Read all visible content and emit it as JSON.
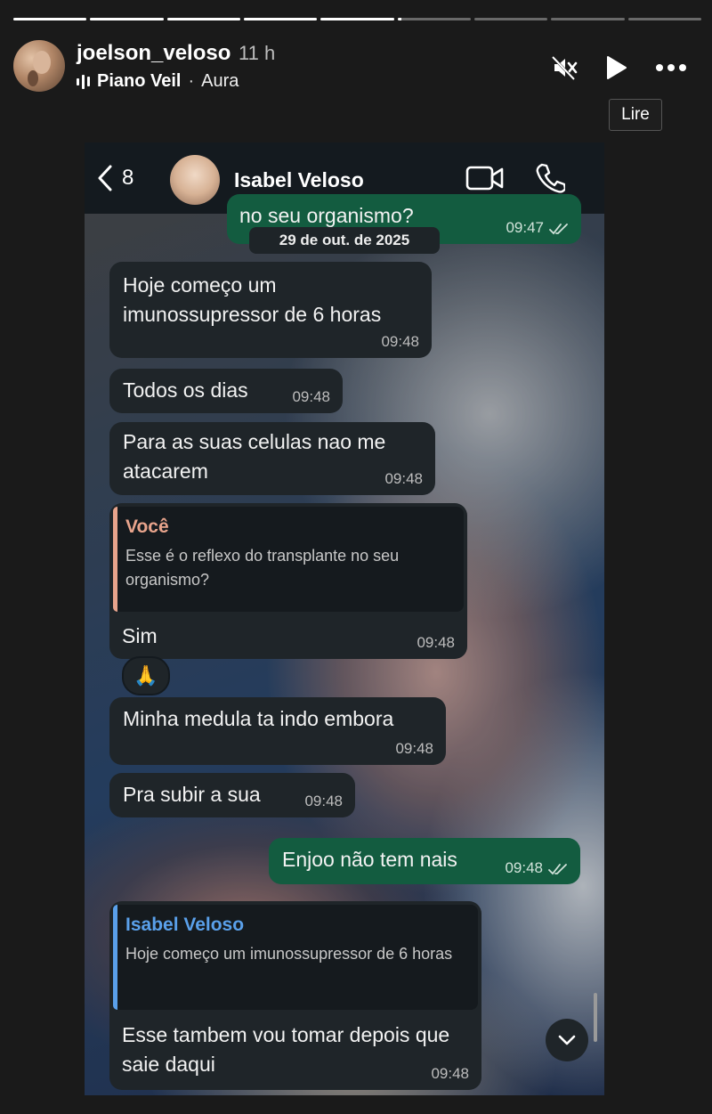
{
  "story": {
    "progress": [
      1,
      1,
      1,
      1,
      1,
      0.05,
      0,
      0,
      0
    ],
    "username": "joelson_veloso",
    "time_ago": "11 h",
    "music": {
      "song": "Piano Veil",
      "separator": "·",
      "artist": "Aura"
    },
    "tooltip": "Lire"
  },
  "chat": {
    "back_count": "8",
    "contact_name": "Isabel Veloso",
    "date_chip": "29 de out. de 2025",
    "messages": [
      {
        "dir": "out",
        "text": "no seu organismo?",
        "time": "09:47"
      },
      {
        "dir": "in",
        "text": "Hoje começo um imunossupressor de 6 horas",
        "time": "09:48"
      },
      {
        "dir": "in",
        "text": "Todos os dias",
        "time": "09:48"
      },
      {
        "dir": "in",
        "text": "Para as suas celulas nao me atacarem",
        "time": "09:48"
      },
      {
        "dir": "in",
        "quote_author": "Você",
        "quote_text": "Esse é o reflexo do transplante no seu organismo?",
        "text": "Sim",
        "time": "09:48",
        "reaction": "🙏"
      },
      {
        "dir": "in",
        "text": "Minha medula ta indo embora",
        "time": "09:48"
      },
      {
        "dir": "in",
        "text": "Pra subir a sua",
        "time": "09:48"
      },
      {
        "dir": "out",
        "text": "Enjoo não tem nais",
        "time": "09:48"
      },
      {
        "dir": "in",
        "quote_author": "Isabel Veloso",
        "quote_text": "Hoje começo um imunossupressor de 6 horas",
        "text": "Esse tambem vou tomar depois que saie daqui",
        "time": "09:48"
      }
    ]
  },
  "colors": {
    "out_bubble": "#135c40",
    "in_bubble": "#1f2529",
    "quote_you": "#e8a48c",
    "quote_contact": "#5aa0ea"
  },
  "icons": [
    "mute-icon",
    "play-icon",
    "more-icon",
    "video-call-icon",
    "phone-call-icon",
    "chevron-down-icon",
    "audio-bars-icon"
  ]
}
